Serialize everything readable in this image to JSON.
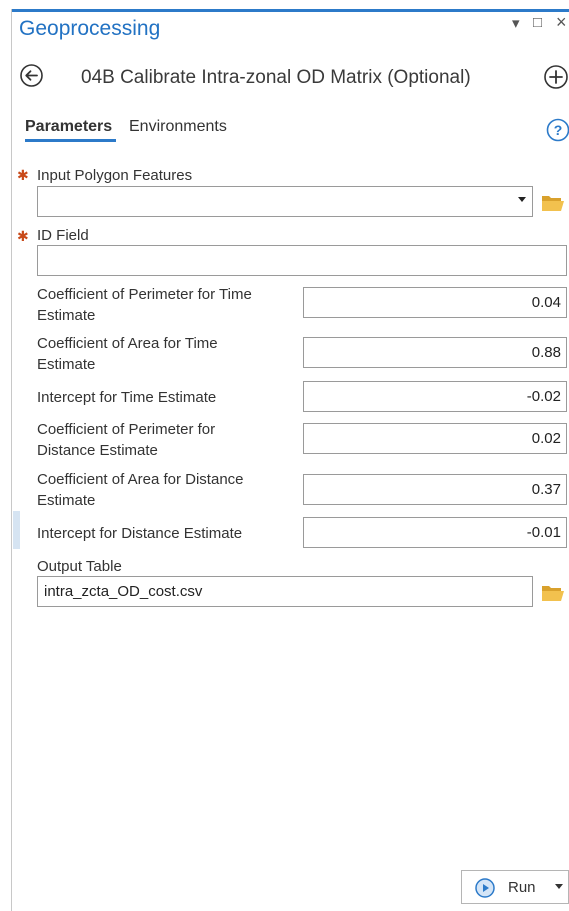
{
  "window": {
    "title": "Geoprocessing",
    "dropdown_glyph": "▾",
    "maximize_glyph": "□",
    "close_glyph": "×"
  },
  "tool": {
    "title": "04B Calibrate Intra-zonal OD Matrix (Optional)"
  },
  "tabs": {
    "parameters": "Parameters",
    "environments": "Environments"
  },
  "params": {
    "input_polygon": {
      "label": "Input Polygon Features",
      "value": "",
      "required_mark": "✱"
    },
    "id_field": {
      "label": "ID Field",
      "value": "",
      "required_mark": "✱"
    },
    "coef_perimeter_time": {
      "label_line1": "Coefficient of Perimeter for Time",
      "label_line2": "Estimate",
      "value": "0.04"
    },
    "coef_area_time": {
      "label_line1": "Coefficient of Area for Time",
      "label_line2": "Estimate",
      "value": "0.88"
    },
    "intercept_time": {
      "label": "Intercept for Time Estimate",
      "value": "-0.02"
    },
    "coef_perimeter_distance": {
      "label_line1": "Coefficient of Perimeter for",
      "label_line2": "Distance Estimate",
      "value": "0.02"
    },
    "coef_area_distance": {
      "label_line1": "Coefficient of Area for Distance",
      "label_line2": "Estimate",
      "value": "0.37"
    },
    "intercept_distance": {
      "label": "Intercept for Distance Estimate",
      "value": "-0.01"
    },
    "output_table": {
      "label": "Output Table",
      "value": "intra_zcta_OD_cost.csv"
    }
  },
  "run": {
    "label": "Run"
  },
  "icons": {
    "back": "circle-arrow-left-icon",
    "add": "circle-plus-icon",
    "help": "help-circle-icon",
    "folder": "folder-open-icon",
    "run": "play-circle-icon"
  },
  "colors": {
    "accent": "#2c7ac9",
    "title_blue": "#2272c3",
    "required": "#c84a1a",
    "folder": "#e8b23a"
  }
}
